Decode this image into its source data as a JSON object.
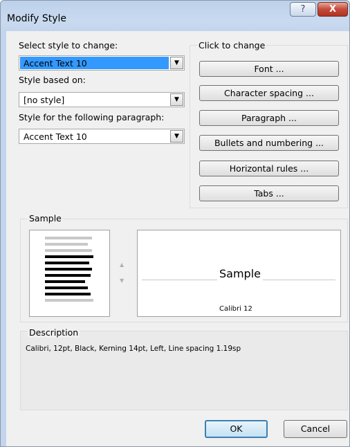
{
  "window": {
    "title": "Modify Style",
    "help_label": "?",
    "close_label": "X"
  },
  "select_style": {
    "label": "Select style to change:",
    "value": "Accent Text 10"
  },
  "based_on": {
    "label": "Style based on:",
    "value": "[no style]"
  },
  "following": {
    "label": "Style for the following paragraph:",
    "value": "Accent Text 10"
  },
  "click_to_change": {
    "label": "Click to change",
    "buttons": [
      "Font ...",
      "Character spacing ...",
      "Paragraph ...",
      "Bullets and numbering ...",
      "Horizontal rules ...",
      "Tabs ..."
    ]
  },
  "sample": {
    "label": "Sample",
    "text": "Sample",
    "font_caption": "Calibri 12"
  },
  "description": {
    "label": "Description",
    "text": "Calibri, 12pt,  Black,  Kerning 14pt, Left, Line spacing 1.19sp"
  },
  "footer": {
    "ok_label": "OK",
    "cancel_label": "Cancel"
  },
  "colors": {
    "selection": "#3399ff",
    "dialog_bg": "#f0f0f0",
    "titlebar": "#c3d5ec",
    "close_button": "#c34a3a"
  }
}
